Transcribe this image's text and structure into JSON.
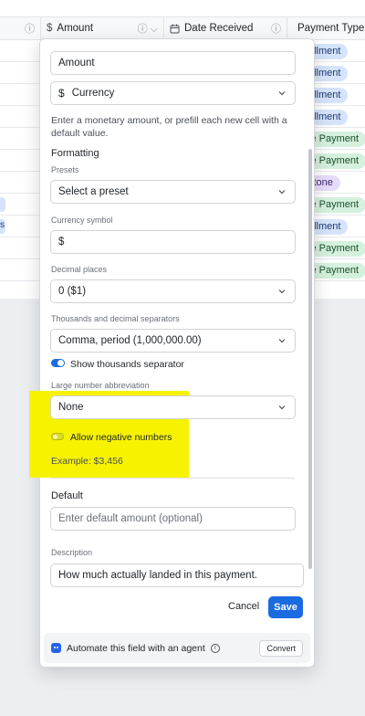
{
  "grid": {
    "columns": [
      {
        "label": "",
        "icon": "info-icon"
      },
      {
        "label": "Amount",
        "icon": "dollar-icon"
      },
      {
        "label": "Date Received",
        "icon": "calendar-icon"
      },
      {
        "label": "Payment Type",
        "icon": "circle-chevron-icon"
      }
    ],
    "column_info_glyph": "ⓘ",
    "payment_pills": [
      {
        "text": "allment",
        "color": "blue"
      },
      {
        "text": "allment",
        "color": "blue"
      },
      {
        "text": "allment",
        "color": "blue"
      },
      {
        "text": "allment",
        "color": "blue"
      },
      {
        "text": "le Payment",
        "color": "green"
      },
      {
        "text": "le Payment",
        "color": "green"
      },
      {
        "text": "stone",
        "color": "purple"
      },
      {
        "text": "le Payment",
        "color": "green"
      },
      {
        "text": "allment",
        "color": "blue"
      },
      {
        "text": "le Payment",
        "color": "green"
      },
      {
        "text": "le Payment",
        "color": "green"
      },
      {
        "text": "",
        "color": "none"
      }
    ],
    "left_edge_glyph": "s"
  },
  "popover": {
    "field_name": "Amount",
    "field_type": {
      "icon": "dollar-icon",
      "glyph": "$",
      "label": "Currency"
    },
    "type_help": "Enter a monetary amount, or prefill each new cell with a default value.",
    "formatting_heading": "Formatting",
    "presets": {
      "label": "Presets",
      "value": "Select a preset"
    },
    "currency_symbol": {
      "label": "Currency symbol",
      "value": "$"
    },
    "decimal_places": {
      "label": "Decimal places",
      "value": "0 ($1)"
    },
    "separators": {
      "label": "Thousands and decimal separators",
      "value": "Comma, period (1,000,000.00)"
    },
    "show_thousands": {
      "label": "Show thousands separator",
      "on": true
    },
    "abbreviation": {
      "label": "Large number abbreviation",
      "value": "None"
    },
    "allow_negative": {
      "label": "Allow negative numbers",
      "on": false
    },
    "example": "Example: $3,456",
    "default_heading": "Default",
    "default_placeholder": "Enter default amount (optional)",
    "description_label": "Description",
    "description_value": "How much actually landed in this payment.",
    "cancel_label": "Cancel",
    "save_label": "Save",
    "footer": {
      "label": "Automate this field with an agent",
      "info_glyph": "i",
      "convert_label": "Convert"
    }
  },
  "colors": {
    "accent": "#1a6ae0",
    "highlight": "#f7f300"
  }
}
